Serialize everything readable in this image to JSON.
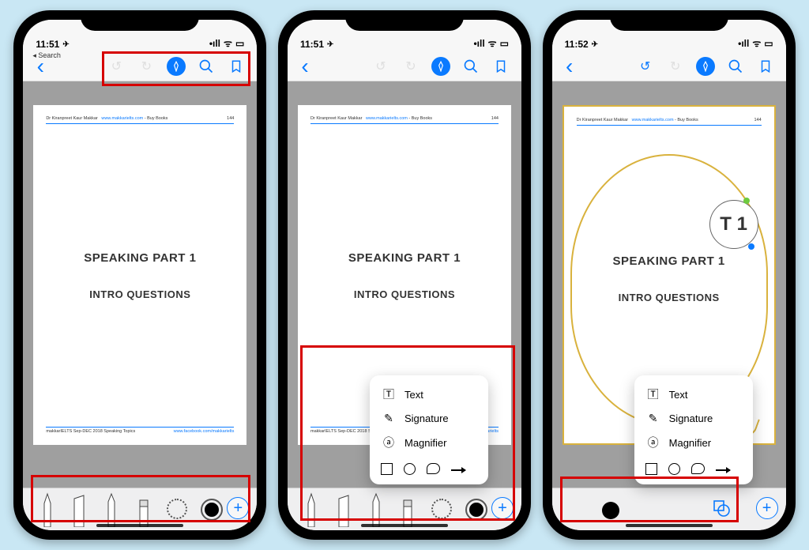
{
  "status": {
    "time1": "11:51",
    "time2": "11:51",
    "time3": "11:52",
    "nav": "✈",
    "back_label": "◂ Search",
    "wifi": "ᯤ",
    "signal": "•ıll",
    "battery": "▭"
  },
  "toolbar": {
    "back": "‹",
    "undo": "↺",
    "redo": "↻",
    "markup": "✎",
    "search": "🔍",
    "bookmark": "▯"
  },
  "document": {
    "author": "Dr Kiranpreet Kaur Makkar",
    "site": "www.makkarielts.com",
    "hdr_tail": " - Buy Books",
    "page_no": "144",
    "title": "SPEAKING PART 1",
    "subtitle": "INTRO QUESTIONS",
    "footer_left": "makkarIELTS Sep-DEC 2018 Speaking Topics",
    "footer_link": "www.facebook.com/makkarielts"
  },
  "popup": {
    "text": "Text",
    "signature": "Signature",
    "magnifier": "Magnifier"
  },
  "loupe_text": "T  1"
}
